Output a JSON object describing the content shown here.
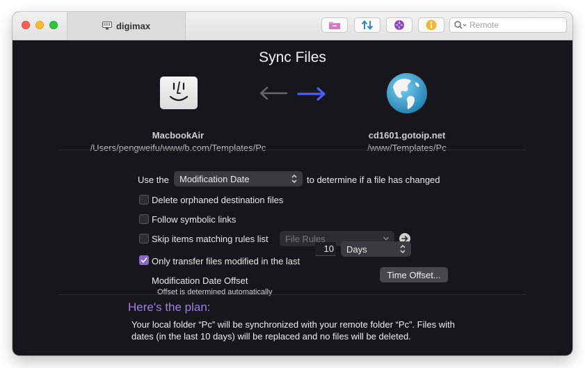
{
  "window": {
    "tab_title": "digimax",
    "search": {
      "placeholder": "Remote",
      "value": ""
    }
  },
  "colors": {
    "accent": "#8a66c8",
    "plan_heading": "#9c82df",
    "background": "#16161c",
    "active_arrow": "#4f5cf5"
  },
  "toolbar_icons": [
    "folder-icon",
    "transfer-arrows-icon",
    "aperture-icon",
    "info-icon"
  ],
  "sync": {
    "heading": "Sync Files",
    "local": {
      "name": "MacbookAir",
      "path": "/Users/pengweifu/www/b.com/Templates/Pc"
    },
    "remote": {
      "name": "cd1601.gotoip.net",
      "path": "/www/Templates/Pc"
    },
    "direction": "local-to-remote"
  },
  "options": {
    "use_the": "Use the",
    "compare_method": "Modification Date",
    "determine_text": "to determine if a file has changed",
    "delete_orphaned": {
      "label": "Delete orphaned destination files",
      "checked": false
    },
    "follow_links": {
      "label": "Follow symbolic links",
      "checked": false
    },
    "skip_items": {
      "label": "Skip items matching rules list",
      "checked": false,
      "rules_value": "File Rules"
    },
    "only_modified": {
      "label": "Only transfer files modified in the last",
      "checked": true,
      "amount": "10",
      "unit": "Days"
    },
    "offset": {
      "title": "Modification Date Offset",
      "subtitle": "Offset is determined automatically",
      "button": "Time Offset..."
    }
  },
  "plan": {
    "title": "Here's the plan:",
    "text": "Your local folder “Pc” will be synchronized with your remote folder “Pc”. Files with dates (in the last 10 days) will be replaced and no files will be deleted."
  }
}
